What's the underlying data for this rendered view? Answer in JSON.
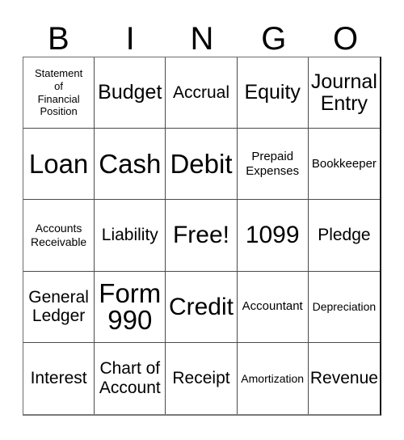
{
  "card": {
    "title": "BINGO",
    "header_letters": [
      "B",
      "I",
      "N",
      "G",
      "O"
    ],
    "grid_rows": 5,
    "grid_cols": 5,
    "border_color": "#4a4a4a",
    "text_color": "#000000",
    "background_color": "#ffffff",
    "free_space": "Free!",
    "cells": [
      [
        {
          "label": "Statement\nof\nFinancial\nPosition",
          "size": "xs"
        },
        {
          "label": "Budget",
          "size": "xl"
        },
        {
          "label": "Accrual",
          "size": "lg"
        },
        {
          "label": "Equity",
          "size": "xl"
        },
        {
          "label": "Journal\nEntry",
          "size": "xl"
        }
      ],
      [
        {
          "label": "Loan",
          "size": "huge"
        },
        {
          "label": "Cash",
          "size": "huge"
        },
        {
          "label": "Debit",
          "size": "huge"
        },
        {
          "label": "Prepaid\nExpenses",
          "size": "md"
        },
        {
          "label": "Bookkeeper",
          "size": "md"
        }
      ],
      [
        {
          "label": "Accounts\nReceivable",
          "size": "sm"
        },
        {
          "label": "Liability",
          "size": "lg"
        },
        {
          "label": "Free!",
          "size": "xxl"
        },
        {
          "label": "1099",
          "size": "xxl"
        },
        {
          "label": "Pledge",
          "size": "lg"
        }
      ],
      [
        {
          "label": "General\nLedger",
          "size": "lg"
        },
        {
          "label": "Form\n990",
          "size": "huge"
        },
        {
          "label": "Credit",
          "size": "xxl"
        },
        {
          "label": "Accountant",
          "size": "md"
        },
        {
          "label": "Depreciation",
          "size": "sm"
        }
      ],
      [
        {
          "label": "Interest",
          "size": "lg"
        },
        {
          "label": "Chart of\nAccount",
          "size": "lg"
        },
        {
          "label": "Receipt",
          "size": "lg"
        },
        {
          "label": "Amortization",
          "size": "sm"
        },
        {
          "label": "Revenue",
          "size": "lg"
        }
      ]
    ]
  }
}
